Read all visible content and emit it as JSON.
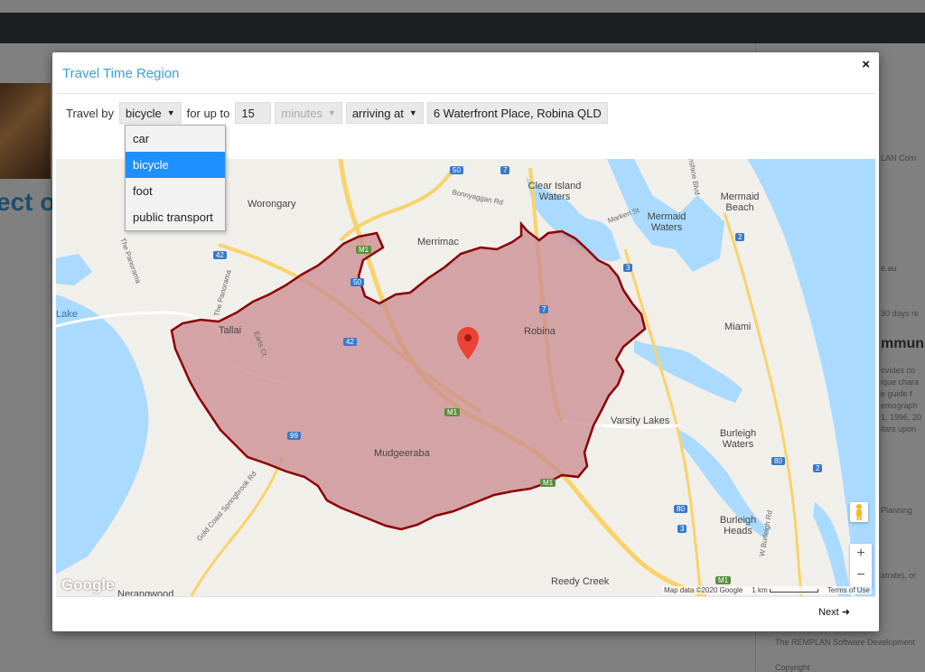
{
  "background": {
    "heading_fragment": "ect o",
    "side_texts": [
      "LAN Com",
      "e.au",
      "30 days re",
      "mmun",
      "ovides co",
      "ique chara",
      "e guide f",
      "emograph",
      "1, 1996, 20",
      "ilars upon",
      "Planning",
      "atrate), or",
      "The REMPLAN Software Development"
    ],
    "side_bottom": "Copyright"
  },
  "modal": {
    "title": "Travel Time Region",
    "close_label": "×",
    "travel_by_label": "Travel by",
    "mode_value": "bicycle",
    "for_up_to_label": "for up to",
    "duration_value": "15",
    "unit_value": "minutes",
    "direction_value": "arriving at",
    "address_value": "6 Waterfront Place, Robina QLD",
    "mode_options": [
      "car",
      "bicycle",
      "foot",
      "public transport"
    ],
    "selected_mode_index": 1,
    "next_label": "Next"
  },
  "map": {
    "places": [
      "Clear Island Waters",
      "Mermaid Waters",
      "Mermaid Beach",
      "Worongary",
      "Merrimac",
      "Tallai",
      "Robina",
      "Miami",
      "Varsity Lakes",
      "Burleigh Waters",
      "Mudgeeraba",
      "Burleigh Heads",
      "Reedy Creek",
      "Lake",
      "Nerangwood"
    ],
    "roads": [
      "Bonnyaggan Rd",
      "Markeri St",
      "Sunshine Blvd",
      "The Panorama",
      "The Panorama",
      "Earls Ct",
      "Gold Coast Springbrook Rd",
      "W Burleigh Rd"
    ],
    "route_shields": [
      "50",
      "7",
      "M1",
      "42",
      "50",
      "7",
      "42",
      "M1",
      "99",
      "M1",
      "3",
      "2",
      "80",
      "2",
      "80",
      "3",
      "M1"
    ],
    "attribution": "Map data ©2020 Google",
    "scale": "1 km",
    "terms": "Terms of Use",
    "google_logo": "Google",
    "zoom_in": "+",
    "zoom_out": "−",
    "colors": {
      "water": "#aadaff",
      "region_fill": "#c98a8f",
      "region_stroke": "#8b0000",
      "road_major": "#f8d36b",
      "pin": "#ea4335"
    }
  }
}
